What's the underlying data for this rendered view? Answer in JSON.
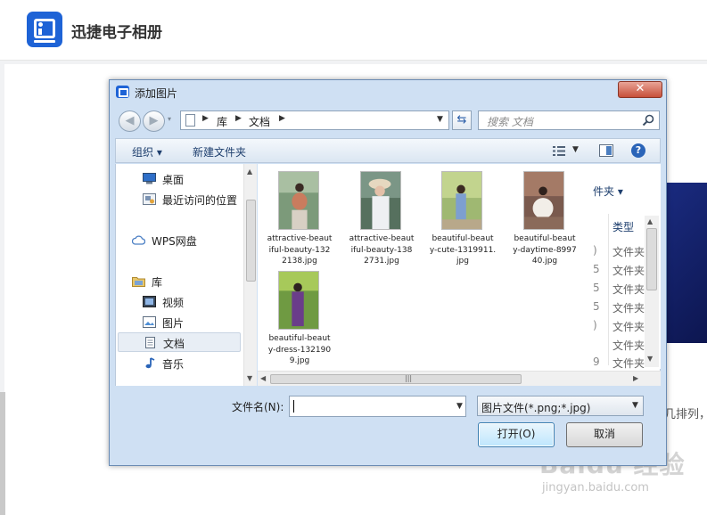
{
  "app": {
    "title": "迅捷电子相册"
  },
  "background": {
    "sort_text": "几排列，",
    "watermark": "Baidu 经验",
    "watermark_url": "jingyan.baidu.com"
  },
  "dialog": {
    "title": "添加图片",
    "close_symbol": "✕",
    "address": {
      "crumbs": [
        "库",
        "文档"
      ]
    },
    "search_placeholder": "搜索 文档",
    "toolbar": {
      "organize": "组织 ▾",
      "new_folder": "新建文件夹"
    },
    "nav": {
      "items": [
        {
          "label": "桌面",
          "icon": "desktop-icon"
        },
        {
          "label": "最近访问的位置",
          "icon": "recent-places-icon"
        },
        {
          "label": "WPS网盘",
          "icon": "cloud-icon"
        },
        {
          "label": "库",
          "icon": "library-icon"
        },
        {
          "label": "视频",
          "icon": "video-icon"
        },
        {
          "label": "图片",
          "icon": "pictures-icon"
        },
        {
          "label": "文档",
          "icon": "documents-icon",
          "selected": true
        },
        {
          "label": "音乐",
          "icon": "music-icon"
        }
      ]
    },
    "files": [
      {
        "caption": "attractive-beautiful-beauty-1322138.jpg",
        "line1": "attractive-beaut",
        "line2": "iful-beauty-132",
        "line3": "2138.jpg"
      },
      {
        "caption": "attractive-beautiful-beauty-1382731.jpg",
        "line1": "attractive-beaut",
        "line2": "iful-beauty-138",
        "line3": "2731.jpg"
      },
      {
        "caption": "beautiful-beauty-cute-1319911.jpg",
        "line1": "beautiful-beaut",
        "line2": "y-cute-1319911.",
        "line3": "jpg"
      },
      {
        "caption": "beautiful-beauty-daytime-899740.jpg",
        "line1": "beautiful-beaut",
        "line2": "y-daytime-8997",
        "line3": "40.jpg"
      },
      {
        "caption": "beautiful-beauty-dress-1321909.jpg",
        "line1": "beautiful-beaut",
        "line2": "y-dress-132190",
        "line3": "9.jpg"
      }
    ],
    "behind": {
      "header": "件夹 ▾",
      "type_header": "类型",
      "cells": [
        "文件夹",
        "文件夹",
        "文件夹",
        "文件夹",
        "文件夹",
        "文件夹",
        "文件夹"
      ],
      "cut": [
        ")",
        "5",
        "5",
        "5",
        ")",
        "9"
      ]
    },
    "filename_label": "文件名(N):",
    "filename_value": "",
    "filter_value": "图片文件(*.png;*.jpg)",
    "open_label": "打开(O)",
    "cancel_label": "取消"
  }
}
